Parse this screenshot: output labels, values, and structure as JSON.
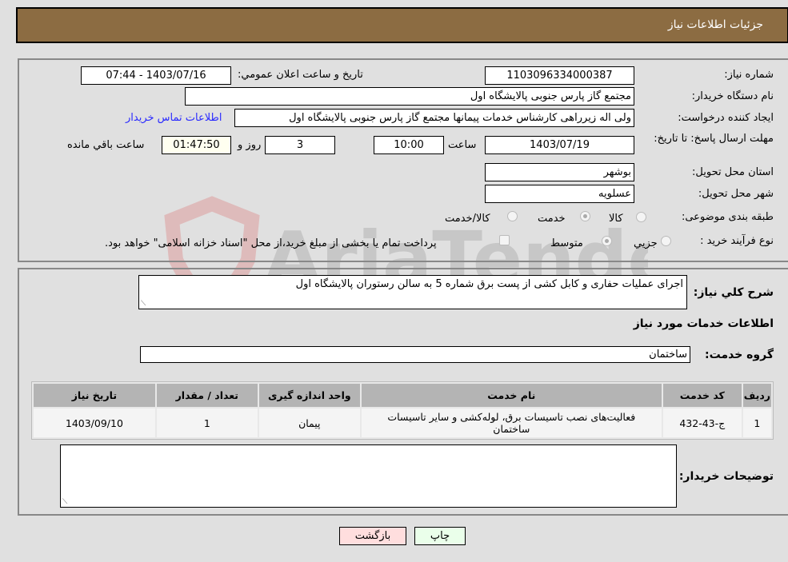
{
  "header": {
    "title": "جزئیات اطلاعات نیاز"
  },
  "form": {
    "need_number": {
      "label": "شماره نیاز:",
      "value": "1103096334000387"
    },
    "announce_datetime": {
      "label": "تاریخ و ساعت اعلان عمومي:",
      "value": "1403/07/16 - 07:44"
    },
    "buyer_org": {
      "label": "نام دستگاه خريدار:",
      "value": "مجتمع گاز پارس جنوبی  پالایشگاه اول"
    },
    "requester": {
      "label": "ایجاد کننده درخواست:",
      "value": "ولی اله زیرراهی کارشناس خدمات پیمانها مجتمع گاز پارس جنوبی  پالایشگاه اول",
      "contact_link": "اطلاعات تماس خریدار"
    },
    "deadline": {
      "label": "مهلت ارسال پاسخ: تا تاریخ:",
      "date": "1403/07/19",
      "time_label": "ساعت",
      "time": "10:00",
      "days": "3",
      "days_label": "روز و",
      "remaining": "01:47:50",
      "remaining_label": "ساعت باقي مانده"
    },
    "province": {
      "label": "استان محل تحویل:",
      "value": "بوشهر"
    },
    "city": {
      "label": "شهر محل تحویل:",
      "value": "عسلویه"
    },
    "category": {
      "label": "طبقه بندی موضوعی:",
      "options": [
        "کالا",
        "خدمت",
        "کالا/خدمت"
      ],
      "selected": "خدمت"
    },
    "purchase_type": {
      "label": "نوع فرآیند خرید :",
      "options": [
        "جزيي",
        "متوسط"
      ],
      "selected": "متوسط",
      "treasury_note": "پرداخت تمام یا بخشی از مبلغ خرید،از محل \"اسناد خزانه اسلامی\" خواهد بود."
    }
  },
  "description": {
    "label": "شرح کلي نياز:",
    "value": "اجرای عملیات حفاری و کابل کشی از پست برق شماره 5 به سالن رستوران پالایشگاه اول"
  },
  "services": {
    "section_title": "اطلاعات خدمات مورد نیاز",
    "group_label": "گروه خدمت:",
    "group_value": "ساختمان",
    "table": {
      "headers": [
        "ردیف",
        "کد خدمت",
        "نام خدمت",
        "واحد اندازه گیری",
        "تعداد / مقدار",
        "تاریخ نیاز"
      ],
      "rows": [
        [
          "1",
          "ج-43-432",
          "فعالیت‌های نصب تاسیسات برق، لوله‌کشی و سایر تاسیسات ساختمان",
          "پیمان",
          "1",
          "1403/09/10"
        ]
      ]
    }
  },
  "buyer_notes": {
    "label": "توضیحات خریدار:",
    "value": ""
  },
  "buttons": {
    "print": "چاپ",
    "back": "بازگشت"
  },
  "colors": {
    "header_bg": "#8c6c42",
    "print_bg": "#eaffea",
    "back_bg": "#ffdede",
    "link": "#2a2aff"
  },
  "watermark": {
    "text": "AriaTender.neT"
  }
}
